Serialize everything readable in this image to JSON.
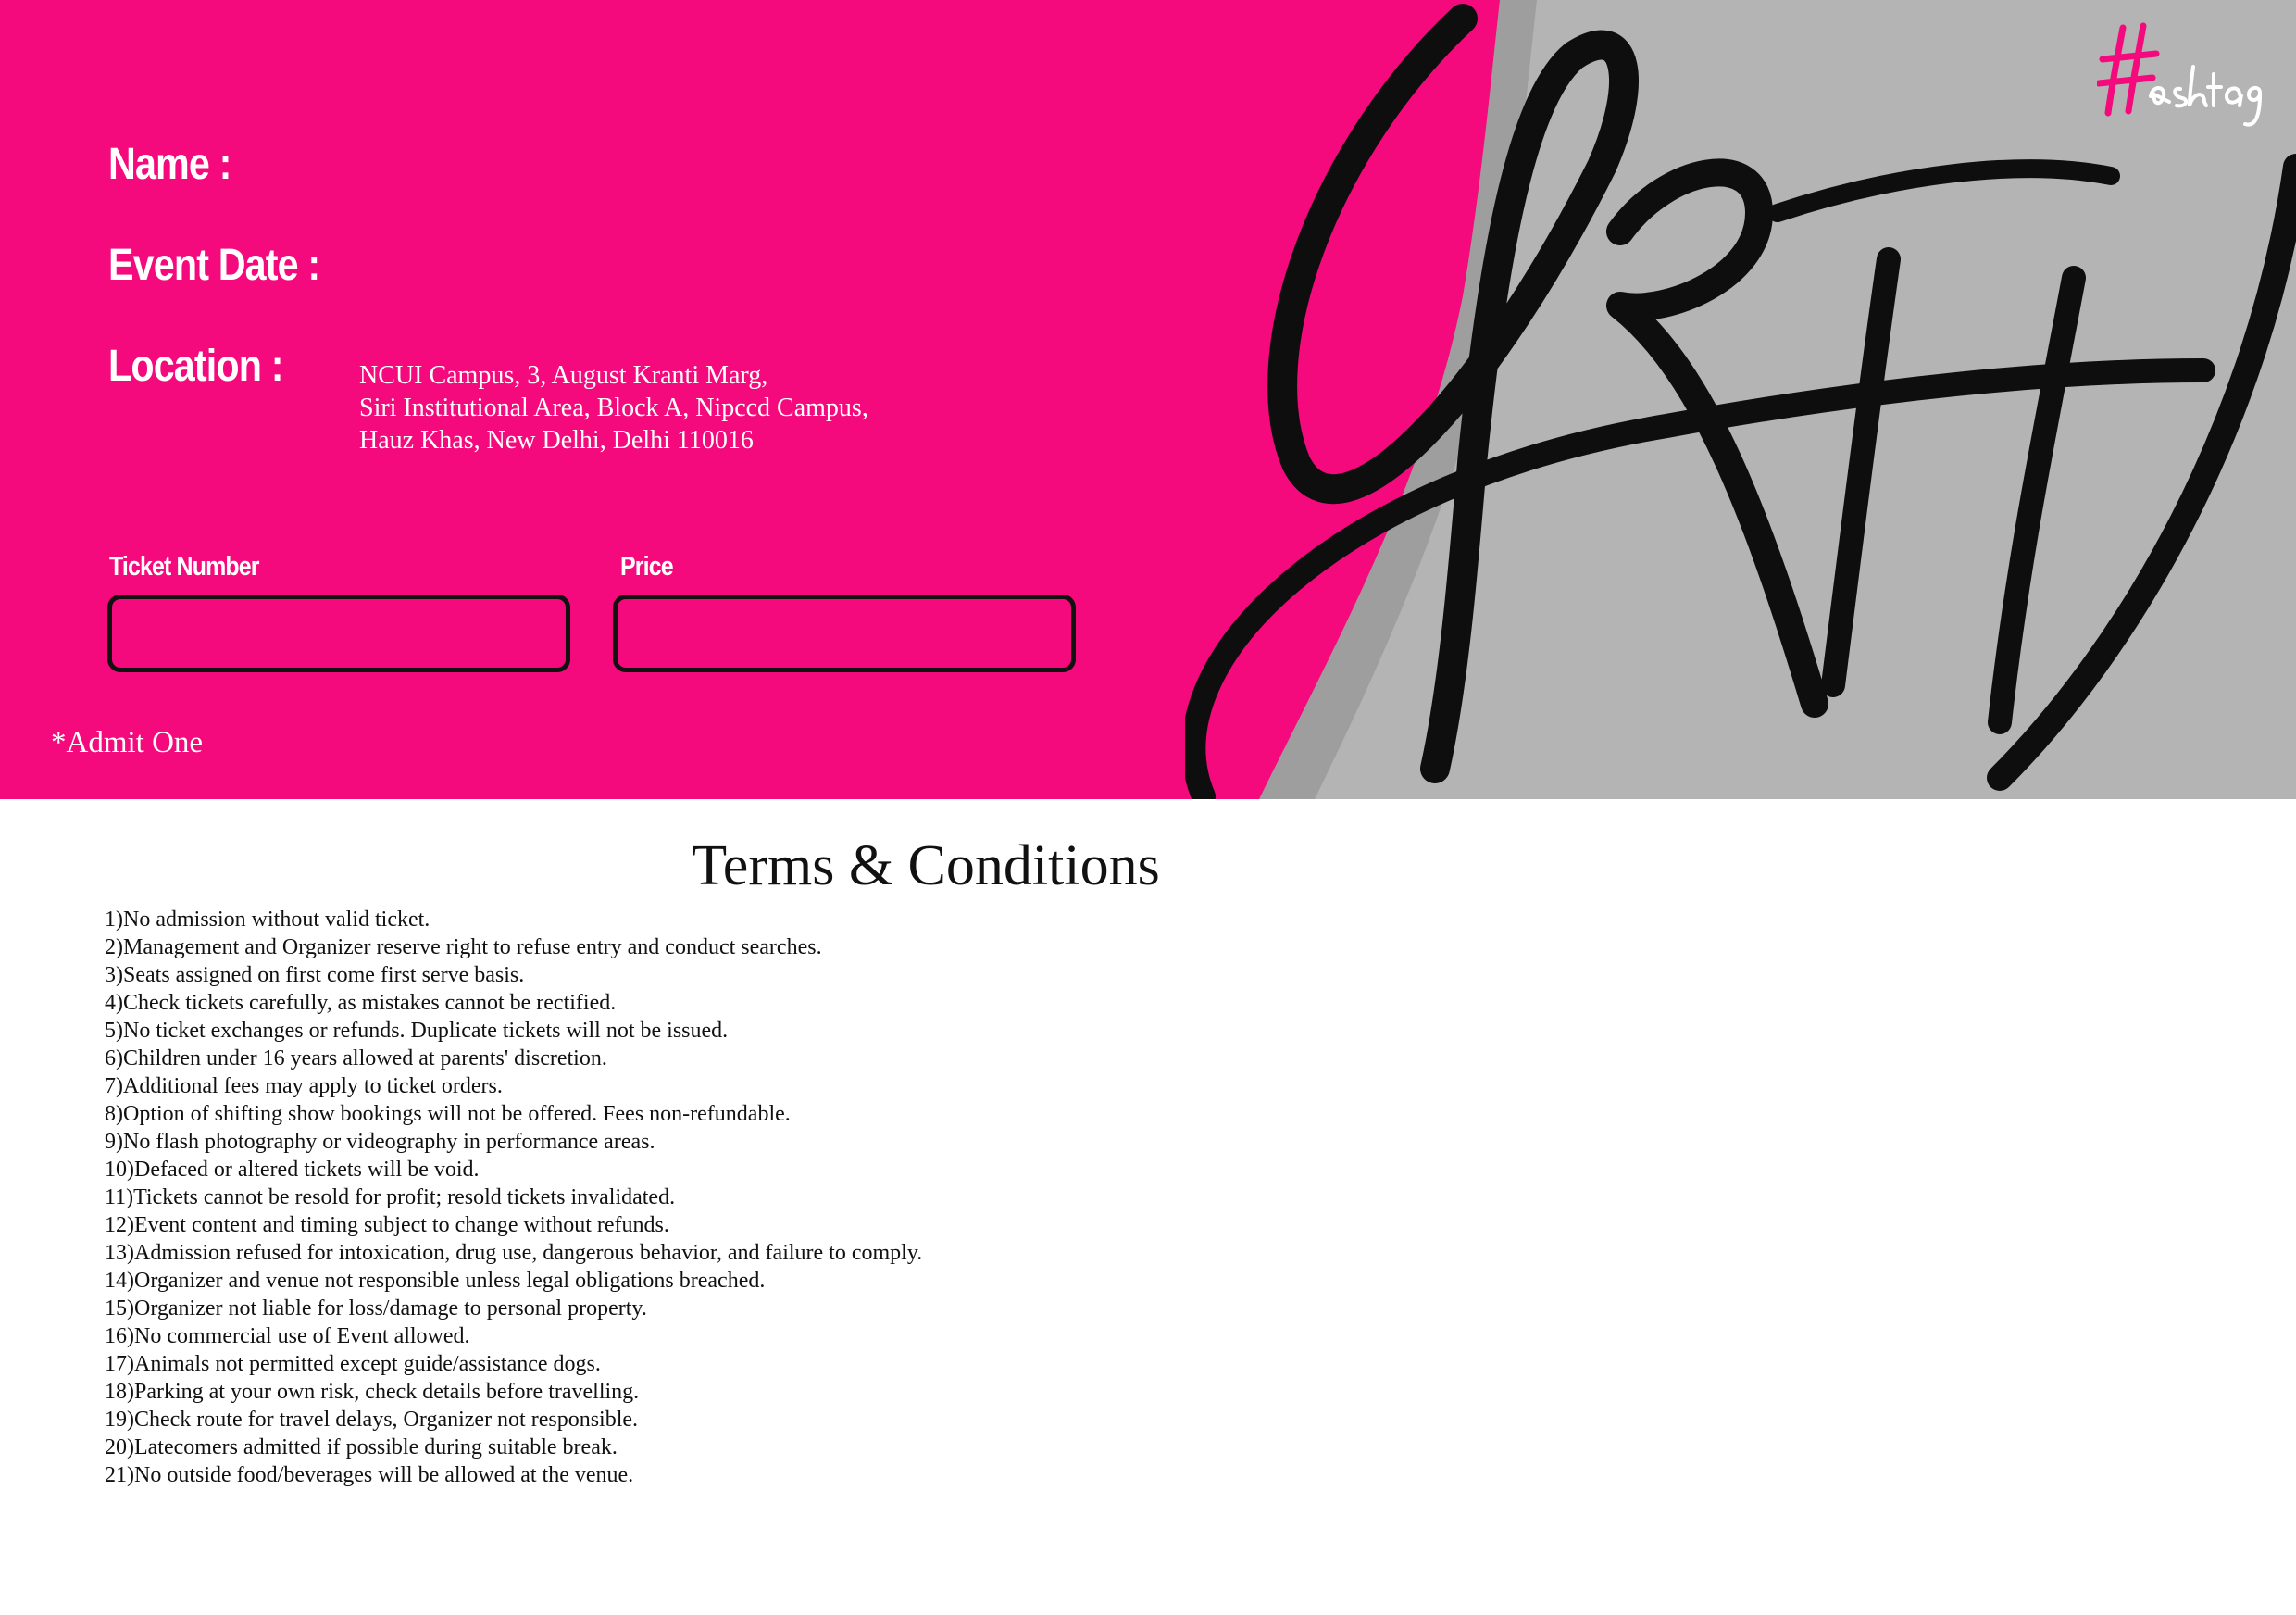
{
  "ticket": {
    "name_label": "Name :",
    "event_date_label": "Event Date :",
    "location_label": "Location :",
    "address_lines": [
      "NCUI Campus, 3, August Kranti Marg,",
      "Siri Institutional Area, Block A, Nipccd Campus,",
      "Hauz Khas, New Delhi, Delhi 110016"
    ],
    "ticket_number_label": "Ticket Number",
    "ticket_number_value": "",
    "price_label": "Price",
    "price_value": "",
    "admit_note": "*Admit One",
    "brand_logo_text": "#ashtag",
    "background_color": "#f40a7c",
    "accent_color": "#f40a7c"
  },
  "terms": {
    "title": "Terms & Conditions",
    "items": [
      "1)No admission without valid ticket.",
      "2)Management and Organizer reserve right to refuse entry and conduct searches.",
      "3)Seats assigned on first come first serve basis.",
      "4)Check tickets carefully, as mistakes cannot be rectified.",
      "5)No ticket exchanges or refunds. Duplicate tickets will not be issued.",
      "6)Children under 16 years allowed at parents' discretion.",
      "7)Additional fees may apply to ticket orders.",
      "8)Option of shifting show bookings will not be offered. Fees non-refundable.",
      "9)No flash photography or videography in performance areas.",
      "10)Defaced or altered tickets will be void.",
      "11)Tickets cannot be resold for profit; resold tickets invalidated.",
      "12)Event content and timing subject to change without refunds.",
      "13)Admission refused for intoxication, drug use, dangerous behavior, and failure to comply.",
      "14)Organizer and venue not responsible unless legal obligations breached.",
      "15)Organizer not liable for loss/damage to personal property.",
      "16)No commercial use of Event allowed.",
      "17)Animals not permitted except guide/assistance dogs.",
      "18)Parking at your own risk, check details before travelling.",
      "19)Check route for travel delays, Organizer not responsible.",
      "20)Latecomers admitted if possible during suitable break.",
      "21)No outside food/beverages will be allowed at the venue."
    ]
  }
}
